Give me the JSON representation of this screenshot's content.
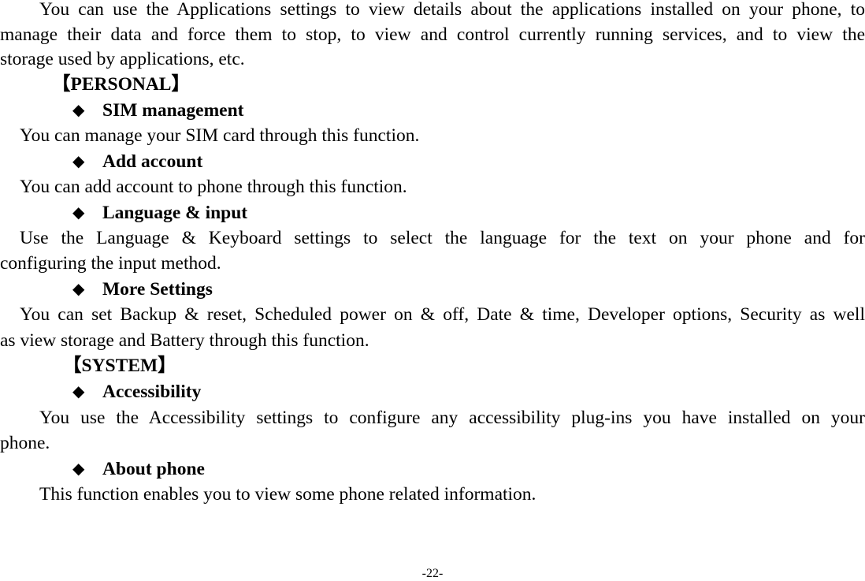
{
  "intro": {
    "lines": [
      "You can use the Applications settings to view details about the applications installed on your phone, to",
      "manage their data and force them to stop, to view and control currently running services, and to view the",
      "storage used by applications, etc."
    ]
  },
  "sections": {
    "personal": "【PERSONAL】",
    "system": "【SYSTEM】"
  },
  "items": {
    "sim": {
      "title": "SIM management",
      "lines": [
        "You can manage your SIM card through this function."
      ]
    },
    "account": {
      "title": "Add account",
      "lines": [
        "You can add account to phone through this function."
      ]
    },
    "language": {
      "title": "Language & input",
      "lines": [
        "Use the Language & Keyboard settings to select the language for the text on your phone and for",
        "configuring the input method."
      ]
    },
    "more": {
      "title": "More Settings",
      "lines": [
        "You can set Backup & reset, Scheduled power on & off, Date & time, Developer options, Security as well",
        "as view storage and Battery through this function."
      ]
    },
    "accessibility": {
      "title": "Accessibility",
      "lines": [
        "You use the Accessibility settings to configure any accessibility plug-ins you have installed on your",
        "phone."
      ]
    },
    "about": {
      "title": "About phone",
      "lines": [
        "This function enables you to view some phone related information."
      ]
    }
  },
  "bullet_glyph": "◆",
  "page_number": "-22-"
}
